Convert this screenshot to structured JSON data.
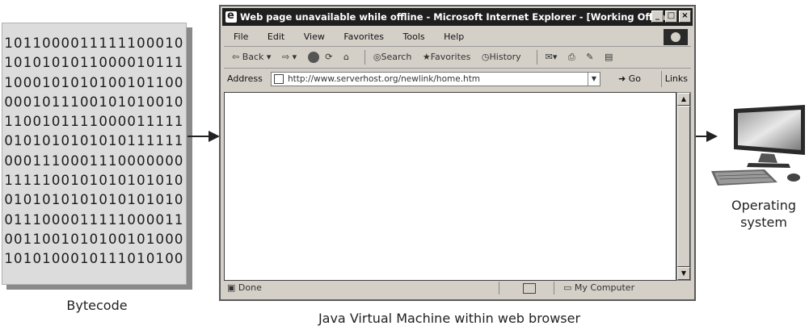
{
  "bytecode": {
    "rows": [
      "1011000011111100010",
      "1010101011000010111",
      "1000101010100101100",
      "0001011100101010010",
      "1100101111000011111",
      "0101010101010111111",
      "0001110001110000000",
      "1111100101010101010",
      "0101010101010101010",
      "0111000011111000011",
      "0011001010100101000",
      "1010100010111010100"
    ],
    "caption": "Bytecode"
  },
  "browser": {
    "title": "Web page unavailable while offline - Microsoft Internet Explorer - [Working Offline]",
    "window_buttons": [
      "_",
      "□",
      "×"
    ],
    "menu": [
      "File",
      "Edit",
      "View",
      "Favorites",
      "Tools",
      "Help"
    ],
    "toolbar": {
      "back": "Back",
      "search": "Search",
      "favorites": "Favorites",
      "history": "History"
    },
    "address_label": "Address",
    "address_value": "http://www.serverhost.org/newlink/home.htm",
    "go_label": "Go",
    "links_label": "Links",
    "status_text": "Done",
    "status_zone": "My Computer",
    "caption": "Java Virtual Machine within web browser"
  },
  "os": {
    "caption_line1": "Operating",
    "caption_line2": "system"
  }
}
